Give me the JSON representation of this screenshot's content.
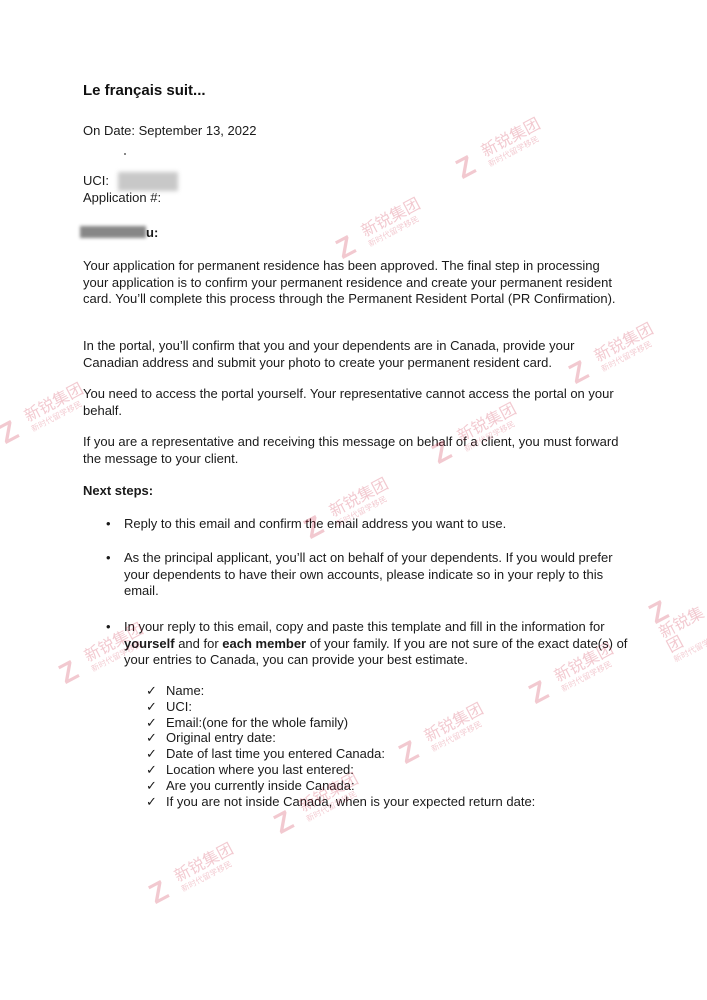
{
  "heading": "Le français suit...",
  "date_line": "On Date: September 13, 2022",
  "uci_label": "UCI:",
  "application_label": "Application #:",
  "salutation_tail": "u:",
  "paragraphs": [
    "Your application for permanent residence has been approved. The final step in processing your application is to confirm your permanent residence and create your permanent resident card. You’ll complete this process through the Permanent Resident Portal (PR Confirmation).",
    "In the portal, you’ll confirm that you and your dependents are in Canada, provide your Canadian address and submit your photo to create your permanent resident card.",
    "You need to access the portal yourself. Your representative cannot access the portal on your behalf.",
    "If you are a representative and receiving this message on behalf of a client, you must forward the message to your client."
  ],
  "next_steps_label": "Next steps:",
  "bullets": [
    {
      "text": "Reply to this email and confirm the email address you want to use."
    },
    {
      "text": "As the principal applicant, you’ll act on behalf of your dependents. If you would prefer your dependents to have their own accounts, please indicate so in your reply to this email."
    },
    {
      "text_a": "In your reply to this email, copy and paste this template and fill in the information for ",
      "bold_a": "yourself",
      "text_b": " and for ",
      "bold_b": "each member",
      "text_c": " of your family. If you are not sure of the exact date(s) of your entries to Canada, you can provide your best estimate."
    }
  ],
  "checklist": [
    "Name:",
    "UCI:",
    "Email:(one for the whole family)",
    "Original entry date:",
    "Date of last time you entered Canada:",
    "Location where you last entered:",
    "Are you currently inside Canada:",
    "If you are not inside Canada, when is your expected return date:"
  ],
  "bullet_glyph": "•",
  "check_glyph": "✓",
  "watermark": {
    "name": "新锐集团",
    "tagline": "新时代留学移民",
    "color": "#c8102e"
  }
}
